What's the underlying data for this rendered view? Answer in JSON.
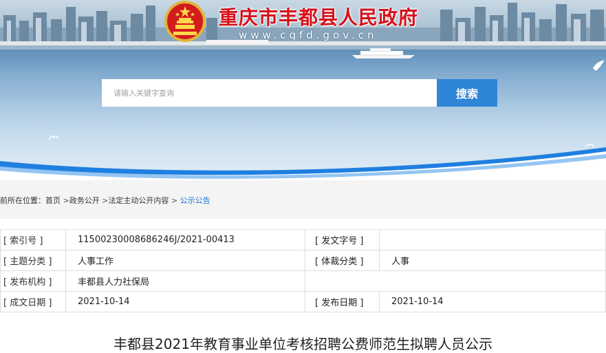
{
  "header": {
    "site_title": "重庆市丰都县人民政府",
    "site_url": "www.cqfd.gov.cn",
    "emblem_icon": "national-emblem-icon"
  },
  "search": {
    "placeholder": "请输入关键字查询",
    "button_label": "搜索"
  },
  "breadcrumb": {
    "prefix": "前所在位置：",
    "items": [
      "首页",
      "政务公开",
      "法定主动公开内容",
      "公示公告"
    ],
    "separator": ">"
  },
  "info": {
    "index_label": "[ 索引号 ]",
    "index_value": "11500230008686246J/2021-00413",
    "doc_no_label": "[ 发文字号 ]",
    "doc_no_value": "",
    "topic_label": "[ 主题分类 ]",
    "topic_value": "人事工作",
    "genre_label": "[ 体裁分类 ]",
    "genre_value": "人事",
    "publisher_label": "[ 发布机构 ]",
    "publisher_value": "丰都县人力社保局",
    "created_label": "[ 成文日期 ]",
    "created_value": "2021-10-14",
    "published_label": "[ 发布日期 ]",
    "published_value": "2021-10-14"
  },
  "article": {
    "title": "丰都县2021年教育事业单位考核招聘公费师范生拟聘人员公示"
  },
  "colors": {
    "title_red": "#d7101a",
    "search_blue": "#2f86d8",
    "link_blue": "#1c6fd0"
  }
}
